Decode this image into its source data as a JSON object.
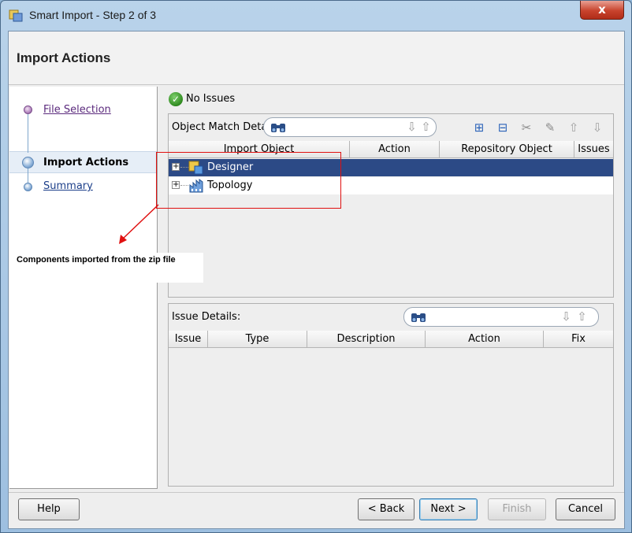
{
  "window": {
    "title": "Smart Import - Step 2 of 3",
    "close_glyph": "x",
    "app_icon": "import-wizard-icon"
  },
  "header": {
    "title": "Import Actions"
  },
  "steps": [
    {
      "label": "File Selection",
      "state": "visited"
    },
    {
      "label": "Import Actions",
      "state": "current"
    },
    {
      "label": "Summary",
      "state": "pending"
    }
  ],
  "status": {
    "icon": "check-icon",
    "glyph": "✓",
    "text": "No Issues"
  },
  "match_panel": {
    "label": "Object Match Details:",
    "columns": [
      "Import Object",
      "Action",
      "Repository Object",
      "Issues"
    ],
    "rows": [
      {
        "label": "Designer",
        "icon": "designer-icon",
        "expander": "+",
        "selected": true
      },
      {
        "label": "Topology",
        "icon": "topology-icon",
        "expander": "+",
        "selected": false
      }
    ],
    "toolbar_icons": [
      "expand-all-icon",
      "collapse-all-icon",
      "scissors-icon",
      "wand-icon",
      "move-up-icon",
      "move-down-icon"
    ]
  },
  "issue_panel": {
    "label": "Issue Details:",
    "columns": [
      "Issue",
      "Type",
      "Description",
      "Action",
      "Fix"
    ]
  },
  "buttons": {
    "help": "Help",
    "back": "< Back",
    "next": "Next >",
    "finish": "Finish",
    "cancel": "Cancel"
  },
  "annotation": {
    "note": "Components imported from the zip file",
    "color": "#e01010"
  },
  "colors": {
    "selection": "#2c4a86",
    "accent_blue": "#3c7fb1"
  }
}
